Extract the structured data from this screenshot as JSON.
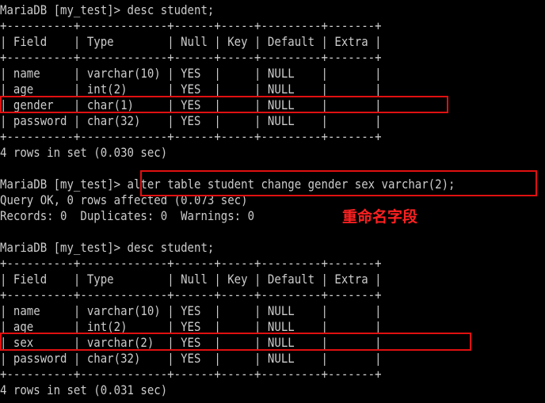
{
  "terminal": {
    "lines": [
      "MariaDB [my_test]> desc student;",
      "+----------+-------------+------+-----+---------+-------+",
      "| Field    | Type        | Null | Key | Default | Extra |",
      "+----------+-------------+------+-----+---------+-------+",
      "| name     | varchar(10) | YES  |     | NULL    |       |",
      "| age      | int(2)      | YES  |     | NULL    |       |",
      "| gender   | char(1)     | YES  |     | NULL    |       |",
      "| password | char(32)    | YES  |     | NULL    |       |",
      "+----------+-------------+------+-----+---------+-------+",
      "4 rows in set (0.030 sec)",
      "",
      "MariaDB [my_test]> alter table student change gender sex varchar(2);",
      "Query OK, 0 rows affected (0.073 sec)",
      "Records: 0  Duplicates: 0  Warnings: 0",
      "",
      "MariaDB [my_test]> desc student;",
      "+----------+-------------+------+-----+---------+-------+",
      "| Field    | Type        | Null | Key | Default | Extra |",
      "+----------+-------------+------+-----+---------+-------+",
      "| name     | varchar(10) | YES  |     | NULL    |       |",
      "| age      | int(2)      | YES  |     | NULL    |       |",
      "| sex      | varchar(2)  | YES  |     | NULL    |       |",
      "| password | char(32)    | YES  |     | NULL    |       |",
      "+----------+-------------+------+-----+---------+-------+",
      "4 rows in set (0.031 sec)"
    ]
  },
  "annotation": {
    "text": "重命名字段",
    "color": "#ff2020"
  },
  "colors": {
    "background": "#000000",
    "text": "#cccccc",
    "highlight_box": "#e01010"
  }
}
